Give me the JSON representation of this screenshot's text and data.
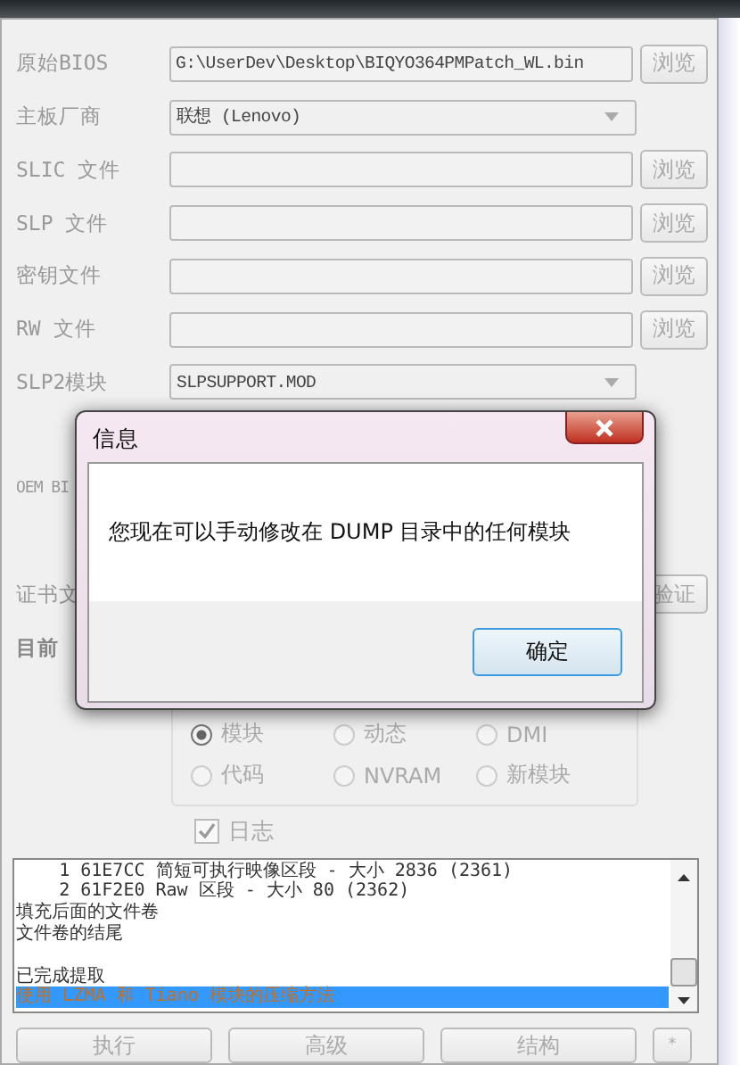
{
  "form": {
    "rows": [
      {
        "label": "原始BIOS",
        "kind": "file",
        "value": "G:\\UserDev\\Desktop\\BIQYO364PMPatch_WL.bin",
        "button": "浏览"
      },
      {
        "label": "主板厂商",
        "kind": "dropdown",
        "value": "联想 (Lenovo)"
      },
      {
        "label": "SLIC 文件",
        "kind": "file",
        "button": "浏览"
      },
      {
        "label": "SLP 文件",
        "kind": "file",
        "button": "浏览"
      },
      {
        "label": "密钥文件",
        "kind": "file",
        "button": "浏览"
      },
      {
        "label": "RW 文件",
        "kind": "file",
        "button": "浏览"
      },
      {
        "label": "SLP2模块",
        "kind": "dropdown",
        "value": "SLPSUPPORT.MOD"
      }
    ],
    "oem_label": "OEM BI",
    "cert_label": "证书文",
    "verify_button": "验证",
    "status_label": "目前",
    "radios": [
      {
        "label": "模块",
        "selected": true
      },
      {
        "label": "动态",
        "selected": false
      },
      {
        "label": "DMI",
        "selected": false
      },
      {
        "label": "代码",
        "selected": false
      },
      {
        "label": "NVRAM",
        "selected": false
      },
      {
        "label": "新模块",
        "selected": false
      }
    ],
    "log_checkbox": {
      "label": "日志",
      "checked": true
    },
    "log": [
      {
        "text": "    1 61E7CC 简短可执行映像区段 - 大小 2836 (2361)",
        "selected": false
      },
      {
        "text": "    2 61F2E0 Raw 区段 - 大小 80 (2362)",
        "selected": false
      },
      {
        "text": "填充后面的文件卷",
        "selected": false
      },
      {
        "text": "文件卷的结尾",
        "selected": false
      },
      {
        "text": "已完成提取",
        "selected": false,
        "blank_before": true
      },
      {
        "text": "使用 LZMA 和 Tiano 模块的压缩方法",
        "selected": true
      }
    ],
    "buttons": [
      "执行",
      "高级",
      "结构",
      "*"
    ]
  },
  "dialog": {
    "title": "信息",
    "message": "您现在可以手动修改在 DUMP 目录中的任何模块",
    "ok": "确定"
  }
}
